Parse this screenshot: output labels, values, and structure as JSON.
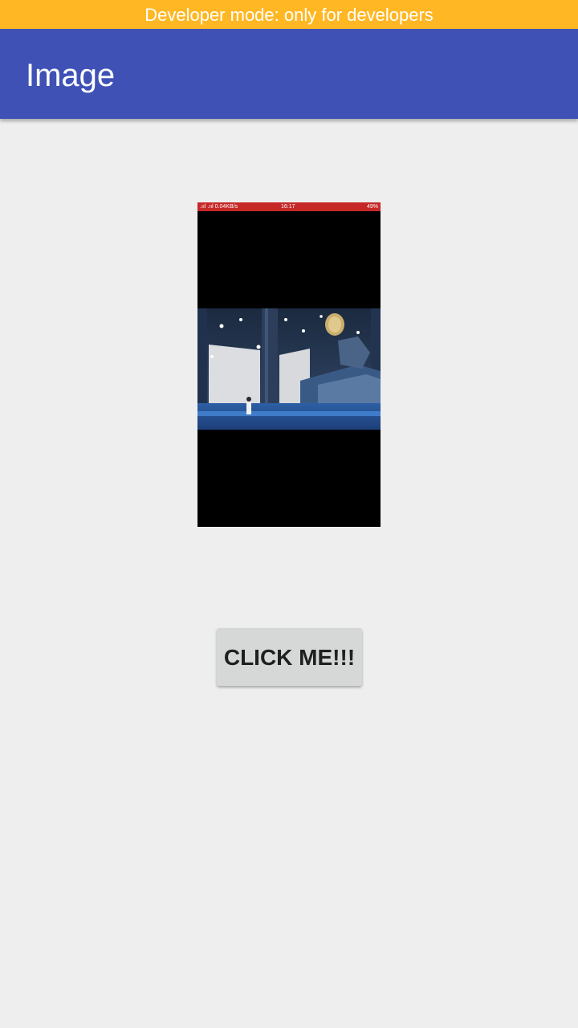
{
  "banner": {
    "text": "Developer mode: only for developers",
    "color": "#ffb724"
  },
  "app_bar": {
    "title": "Image",
    "color": "#3f51b5"
  },
  "image_view": {
    "status_bar": {
      "left": ".ııl .ııl 0.04KB/s",
      "time": "16:17",
      "right": "49%",
      "color": "#c62828"
    }
  },
  "button": {
    "label": "CLICK ME!!!"
  },
  "background_color": "#eeeeee"
}
